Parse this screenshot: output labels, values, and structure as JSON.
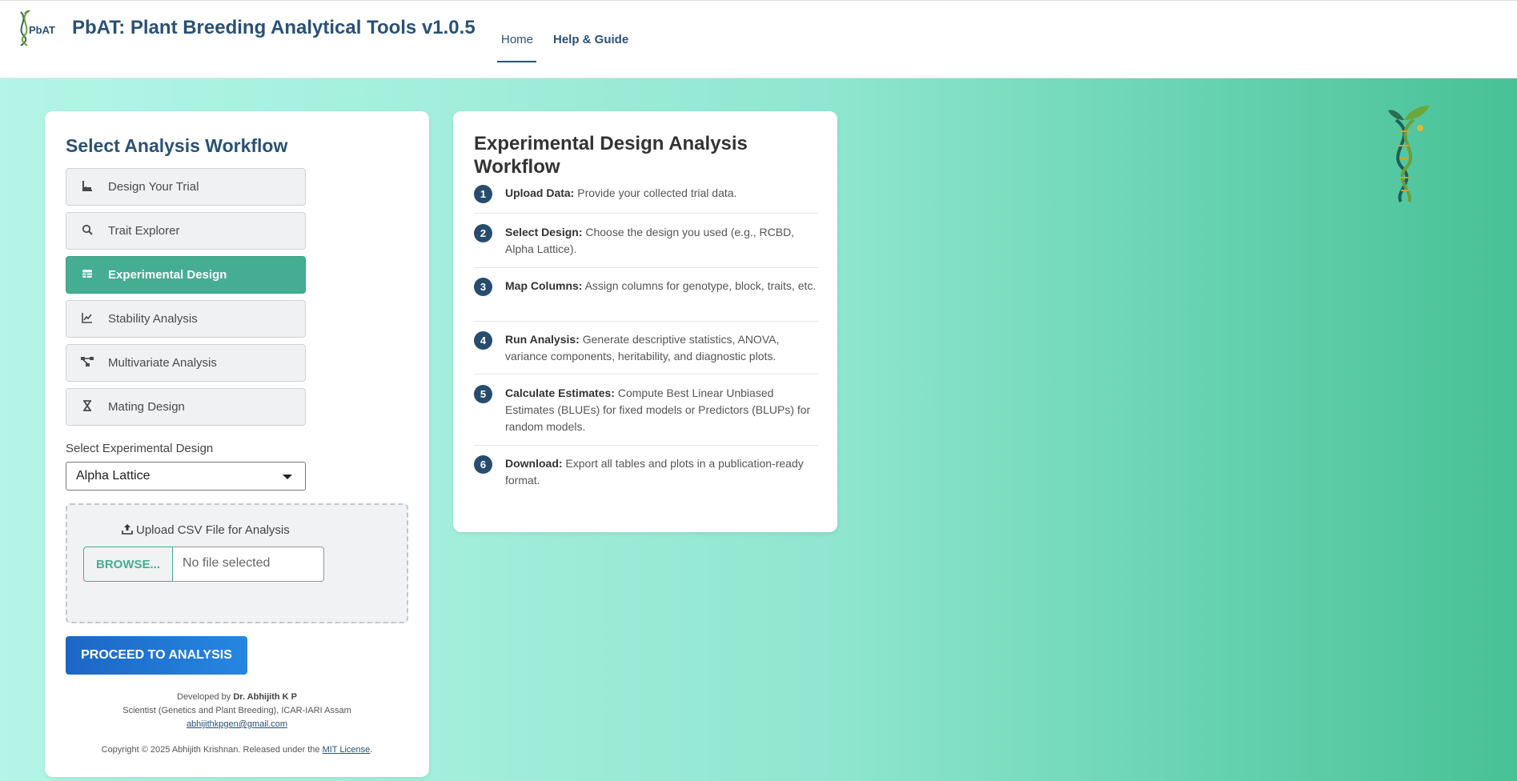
{
  "header": {
    "logo_text": "PbAT",
    "title": "PbAT: Plant Breeding Analytical Tools v1.0.5",
    "nav": [
      {
        "label": "Home"
      },
      {
        "label": "Help & Guide"
      }
    ]
  },
  "left": {
    "heading": "Select Analysis Workflow",
    "workflows": [
      {
        "label": "Design Your Trial",
        "icon": "ruler-icon"
      },
      {
        "label": "Trait Explorer",
        "icon": "search-icon"
      },
      {
        "label": "Experimental Design",
        "icon": "table-icon"
      },
      {
        "label": "Stability Analysis",
        "icon": "line-chart-icon"
      },
      {
        "label": "Multivariate Analysis",
        "icon": "network-icon"
      },
      {
        "label": "Mating Design",
        "icon": "hourglass-icon"
      }
    ],
    "select_label": "Select Experimental Design",
    "select_value": "Alpha Lattice",
    "upload_label": "Upload CSV File for Analysis",
    "browse_label": "BROWSE...",
    "file_placeholder": "No file selected",
    "proceed_label": "PROCEED TO ANALYSIS",
    "footer": {
      "dev_prefix": "Developed by ",
      "dev_name": "Dr. Abhijith K P",
      "affiliation": "Scientist (Genetics and Plant Breeding), ICAR-IARI Assam",
      "email": "abhijithkpgen@gmail.com",
      "copyright_prefix": "Copyright © 2025 Abhijith Krishnan. Released under the ",
      "license": "MIT License",
      "copyright_suffix": "."
    }
  },
  "right": {
    "heading": "Experimental Design Analysis Workflow",
    "steps": [
      {
        "num": "1",
        "title": "Upload Data:",
        "text": " Provide your collected trial data."
      },
      {
        "num": "2",
        "title": "Select Design:",
        "text": " Choose the design you used (e.g., RCBD, Alpha Lattice)."
      },
      {
        "num": "3",
        "title": "Map Columns:",
        "text": " Assign columns for genotype, block, traits, etc."
      },
      {
        "num": "4",
        "title": "Run Analysis:",
        "text": " Generate descriptive statistics, ANOVA, variance components, heritability, and diagnostic plots."
      },
      {
        "num": "5",
        "title": "Calculate Estimates:",
        "text": " Compute Best Linear Unbiased Estimates (BLUEs) for fixed models or Predictors (BLUPs) for random models."
      },
      {
        "num": "6",
        "title": "Download:",
        "text": " Export all tables and plots in a publication-ready format."
      }
    ]
  },
  "colors": {
    "brand": "#2a5175",
    "accent": "#45ad92",
    "proceed": "#1d66c4",
    "step_badge": "#274c6e"
  }
}
